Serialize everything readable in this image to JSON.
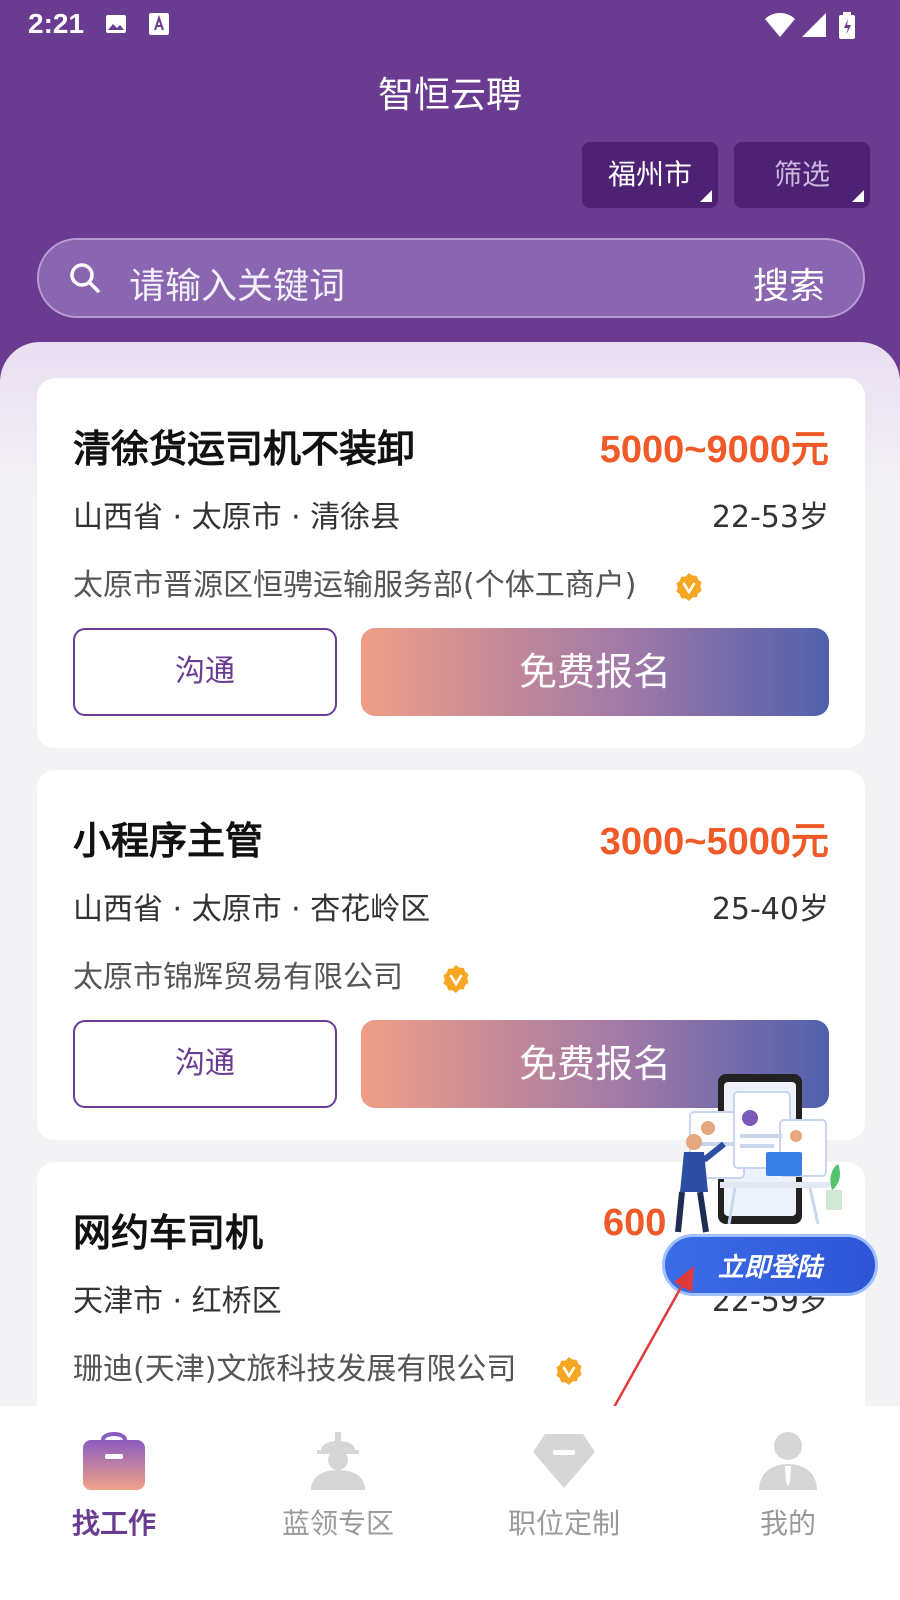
{
  "status": {
    "time": "2:21"
  },
  "header": {
    "title": "智恒云聘",
    "city": "福州市",
    "filter": "筛选"
  },
  "search": {
    "placeholder": "请输入关键词",
    "button": "搜索"
  },
  "jobs": [
    {
      "title": "清徐货运司机不装卸",
      "salary": "5000~9000元",
      "location": "山西省 · 太原市 · 清徐县",
      "age": "22-53岁",
      "company": "太原市晋源区恒骋运输服务部(个体工商户)",
      "chat": "沟通",
      "apply": "免费报名"
    },
    {
      "title": "小程序主管",
      "salary": "3000~5000元",
      "location": "山西省 · 太原市 · 杏花岭区",
      "age": "25-40岁",
      "company": "太原市锦辉贸易有限公司",
      "chat": "沟通",
      "apply": "免费报名"
    },
    {
      "title": "网约车司机",
      "salary": "600",
      "location": "天津市 · 红桥区",
      "age": "22-59岁",
      "company": "珊迪(天津)文旅科技发展有限公司"
    }
  ],
  "float_login": "立即登陆",
  "tabs": [
    {
      "label": "找工作",
      "icon": "briefcase-icon",
      "active": true
    },
    {
      "label": "蓝领专区",
      "icon": "worker-helmet-icon",
      "active": false
    },
    {
      "label": "职位定制",
      "icon": "diamond-icon",
      "active": false
    },
    {
      "label": "我的",
      "icon": "user-icon",
      "active": false
    }
  ],
  "colors": {
    "primary": "#6a3c91",
    "salary": "#f05a28",
    "badge": "#f5a623"
  }
}
